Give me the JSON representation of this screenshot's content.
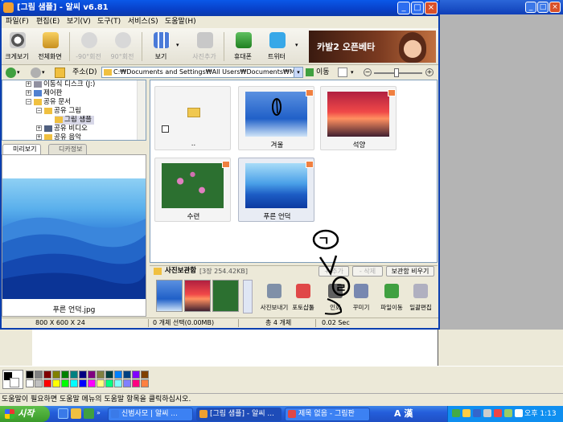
{
  "alsee": {
    "title": "[그림 샘플] - 알씨 v6.81",
    "menu": [
      "파일(F)",
      "편집(E)",
      "보기(V)",
      "도구(T)",
      "서비스(S)",
      "도움말(H)"
    ],
    "toolbar": {
      "full_view": "크게보기",
      "full_screen": "전체화면",
      "rotate_left": "-90°회전",
      "rotate_right": "90°회전",
      "view": "보기",
      "add_photo": "사진추가",
      "mobile": "휴대폰",
      "twitter": "트위터"
    },
    "ad_text": "카발2 오픈베타",
    "address": {
      "label": "주소(D)",
      "value": "C:₩Documents and Settings₩All Users₩Documents₩My",
      "go": "이동"
    },
    "tree": [
      {
        "label": "이동식 디스크 (J:)",
        "indent": 2
      },
      {
        "label": "제어판",
        "indent": 2
      },
      {
        "label": "공유 문서",
        "indent": 2
      },
      {
        "label": "공유 그림",
        "indent": 3
      },
      {
        "label": "그림 샘플",
        "indent": 4
      },
      {
        "label": "공유 비디오",
        "indent": 3
      },
      {
        "label": "공유 음악",
        "indent": 3
      }
    ],
    "preview_tabs": {
      "preview": "미리보기",
      "exif": "디카정보"
    },
    "preview_caption": "푸른 언덕.jpg",
    "thumbnails": [
      {
        "caption": ".."
      },
      {
        "caption": "겨울"
      },
      {
        "caption": "석양"
      },
      {
        "caption": "수련"
      },
      {
        "caption": "푸른 언덕"
      }
    ],
    "photo_box": {
      "title": "사진보관함",
      "count": "[3장 254.42KB]",
      "add_btn": "+ 추가",
      "remove_btn": "- 삭제",
      "empty_btn": "보관함 비우기",
      "actions": [
        "사진보내기",
        "포토샵툴",
        "인화",
        "꾸미기",
        "파일이동",
        "일괄편집"
      ]
    },
    "status": {
      "dimensions": "800 X 600 X 24",
      "selection": "0 개체 선택(0.00MB)",
      "total": "총 4 개체",
      "time": "0.02 Sec"
    }
  },
  "paint": {
    "status_text": "도움말이 필요하면 도움말 메뉴의 도움말 항목을 클릭하십시오.",
    "palette": [
      "#000000",
      "#808080",
      "#800000",
      "#808000",
      "#008000",
      "#008080",
      "#000080",
      "#800080",
      "#808040",
      "#004040",
      "#0080ff",
      "#004080",
      "#8000ff",
      "#804000",
      "#ffffff",
      "#c0c0c0",
      "#ff0000",
      "#ffff00",
      "#00ff00",
      "#00ffff",
      "#0000ff",
      "#ff00ff",
      "#ffff80",
      "#00ff80",
      "#80ffff",
      "#8080ff",
      "#ff0080",
      "#ff8040"
    ]
  },
  "taskbar": {
    "start": "시작",
    "tasks": [
      "신범사모 | 알씨 ...",
      "[그림 샘플] - 알씨 ...",
      "제목 없음 - 그림판"
    ],
    "ime": "A 漢",
    "clock": "오후 1:13"
  },
  "scribble_text": [
    "ㄱ",
    "ㄹ"
  ]
}
